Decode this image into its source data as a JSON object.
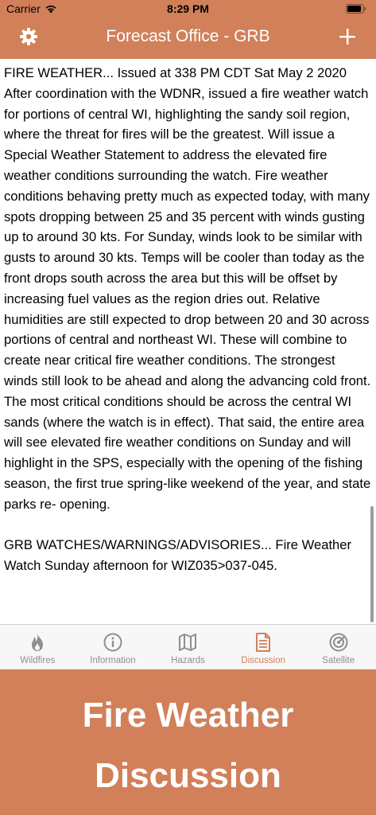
{
  "status_bar": {
    "carrier": "Carrier",
    "time": "8:29 PM",
    "battery_level": 0.9
  },
  "nav": {
    "title": "Forecast Office - GRB",
    "left_icon": "gear-icon",
    "right_icon": "plus-icon"
  },
  "discussion": {
    "paragraphs": [
      "FIRE WEATHER... Issued at 338 PM CDT Sat May 2 2020 After coordination with the WDNR, issued a fire weather watch for portions of central WI, highlighting the sandy soil region, where the threat for fires will be the greatest. Will issue a Special Weather Statement to address the elevated fire weather conditions surrounding the watch. Fire weather conditions behaving pretty much as expected today, with many spots dropping between 25 and 35 percent with winds gusting up to around 30 kts. For Sunday, winds look to be similar with gusts to around 30 kts. Temps will be cooler than today as the front drops south across the area but this will be offset by increasing fuel values as the region dries out. Relative humidities are still expected to drop between 20 and 30 across portions of central and northeast WI. These will combine to create near critical fire weather conditions. The strongest winds still look to be ahead and along the advancing cold front. The most critical conditions should be across the central WI sands (where the watch is in effect). That said, the entire area will see elevated fire weather conditions on Sunday and will highlight in the SPS, especially with the opening of the fishing season, the first true spring-like weekend of the year, and state parks re- opening.",
      "GRB WATCHES/WARNINGS/ADVISORIES... Fire Weather Watch Sunday afternoon for WIZ035>037-045."
    ]
  },
  "tabs": [
    {
      "label": "Wildfires",
      "icon": "flame-icon",
      "active": false
    },
    {
      "label": "Information",
      "icon": "info-icon",
      "active": false
    },
    {
      "label": "Hazards",
      "icon": "map-icon",
      "active": false
    },
    {
      "label": "Discussion",
      "icon": "document-icon",
      "active": true
    },
    {
      "label": "Satellite",
      "icon": "satellite-icon",
      "active": false
    }
  ],
  "banner": {
    "line1": "Fire Weather",
    "line2": "Discussion"
  },
  "colors": {
    "accent": "#d1805a",
    "tab_inactive": "#8e8e93",
    "tabbar_bg": "#f7f7f7"
  }
}
